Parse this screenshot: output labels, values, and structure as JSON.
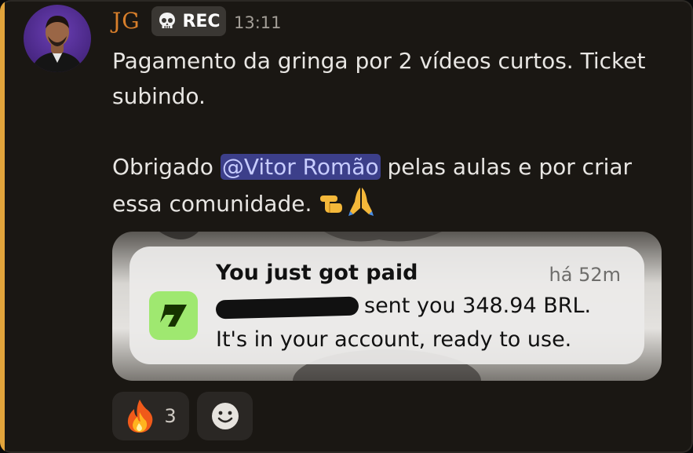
{
  "message": {
    "author": "JG",
    "badge": {
      "label": "REC",
      "icon": "skull-icon"
    },
    "time": "13:11",
    "paragraph1": "Pagamento da gringa por 2 vídeos curtos. Ticket subindo.",
    "paragraph2_before": "Obrigado ",
    "mention": "@Vitor Romão",
    "paragraph2_after": " pelas aulas e por criar essa comunidade.",
    "emojis": [
      "pointing-hand-icon",
      "folded-hands-icon"
    ]
  },
  "attachment": {
    "notification": {
      "title": "You just got paid",
      "time": "há 52m",
      "line1": "sent you 348.94 BRL.",
      "line2": "It's in your account, ready to use.",
      "app_icon": "wise-app-icon"
    }
  },
  "reactions": [
    {
      "emoji": "fire-icon",
      "count": "3"
    }
  ],
  "add_reaction_icon": "smiley-icon",
  "colors": {
    "accent_bar": "#e2a43b",
    "username": "#d87f2b",
    "mention_bg": "#3c3f8a",
    "app_icon_bg": "#9fe870"
  }
}
